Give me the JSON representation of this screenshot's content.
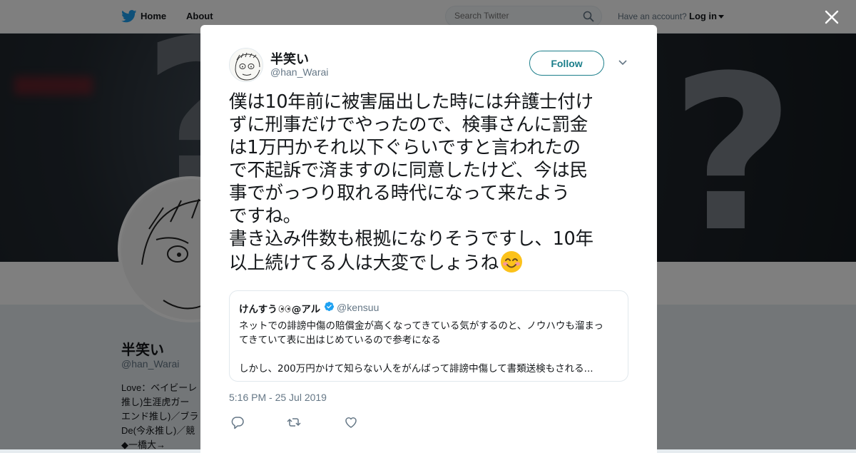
{
  "nav": {
    "home": "Home",
    "about": "About",
    "search_placeholder": "Search Twitter",
    "have_account": "Have an account?",
    "login": "Log in"
  },
  "profile": {
    "name": "半笑い",
    "handle": "@han_Warai",
    "bio_lines": [
      "Love：ベイビーレ",
      "推し)生涯虎ガー",
      "エンド推し)／ブラ",
      "De(今永推し)／競",
      "◆一橋大→"
    ]
  },
  "tweet": {
    "author_name": "半笑い",
    "author_handle": "@han_Warai",
    "follow_label": "Follow",
    "text_lines": [
      "僕は10年前に被害届出した時には弁護士付け",
      "ずに刑事だけでやったので、検事さんに罰金",
      "は1万円かそれ以下ぐらいですと言われたの",
      "で不起訴で済ますのに同意したけど、今は民",
      "事でがっつり取れる時代になって来たよう",
      "ですね。",
      "書き込み件数も根拠になりそうですし、10年",
      "以上続けてる人は大変でしょうね"
    ],
    "emoji": "smiling-face-with-smiling-eyes",
    "timestamp": "5:16 PM - 25 Jul 2019"
  },
  "quote": {
    "name_prefix": "けんすう",
    "name_suffix": "@アル",
    "handle": "@kensuu",
    "lines": [
      "ネットでの誹謗中傷の賠償金が高くなってきている気がするのと、ノウハウも溜まっ",
      "てきていて表に出はじめているので参考になる",
      "しかし、200万円かけて知らない人をがんばって誹謗中傷して書類送検もされる..."
    ]
  },
  "icons": {
    "logo": "twitter-bird-icon",
    "search": "search-icon",
    "close": "close-icon",
    "caret": "chevron-down-icon",
    "verified": "verified-badge-icon",
    "reply": "reply-icon",
    "retweet": "retweet-icon",
    "like": "heart-icon"
  },
  "colors": {
    "brand": "#1da1f2",
    "follow": "#1b7e8a",
    "muted": "#657786"
  }
}
